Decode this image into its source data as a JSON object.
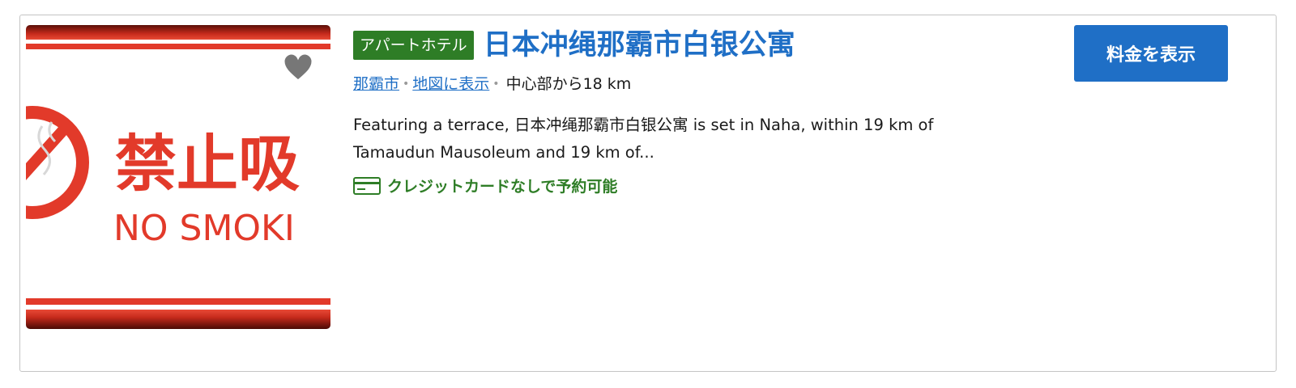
{
  "listing": {
    "property_type": "アパートホテル",
    "name": "日本冲绳那霸市白银公寓",
    "city_link": "那霸市",
    "map_link": "地図に表示",
    "distance": "中心部から18 km",
    "description": "Featuring a terrace, 日本冲绳那霸市白银公寓 is set in Naha, within 19 km of Tamaudun Mausoleum and 19 km of...",
    "perk": "クレジットカードなしで予約可能",
    "cta_label": "料金を表示",
    "favorite_icon": "heart-icon",
    "perk_icon": "credit-card-icon"
  },
  "photo": {
    "sign_jp": "禁止吸",
    "sign_en": "NO SMOKI"
  },
  "colors": {
    "brand_blue": "#1f6fc6",
    "badge_green": "#2e7d26",
    "sign_red": "#e23a2a",
    "border": "#c4c4c4"
  }
}
